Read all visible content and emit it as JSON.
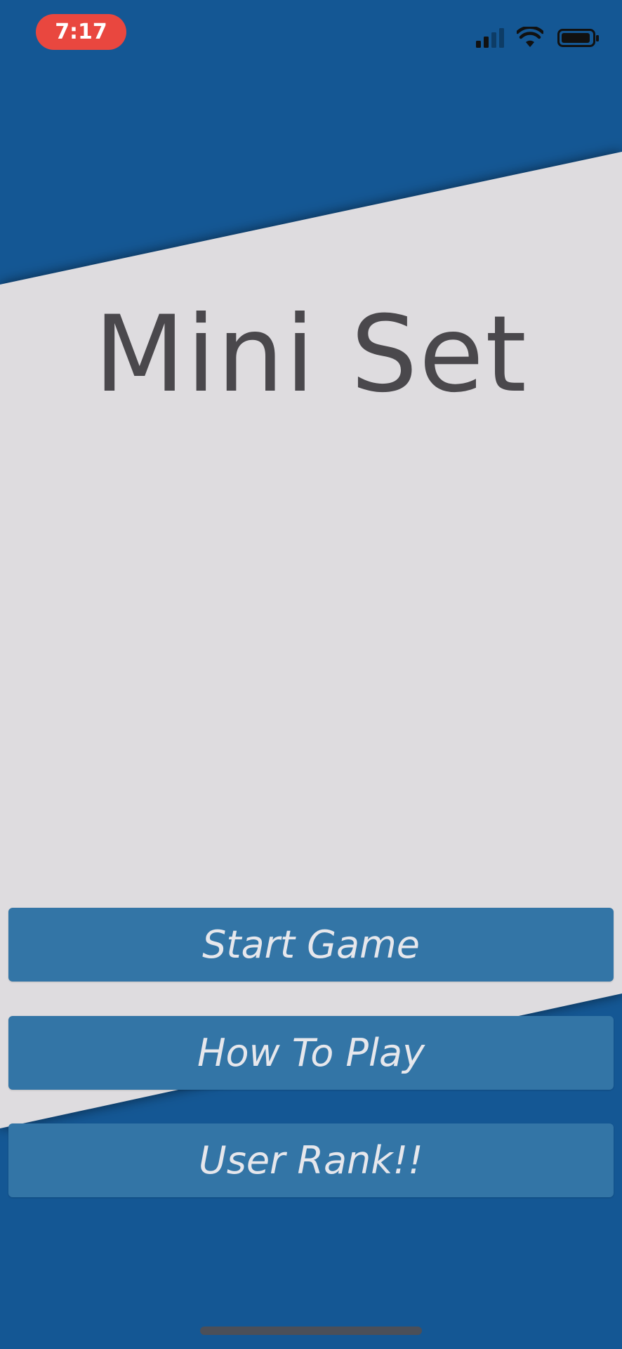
{
  "status_bar": {
    "time": "7:17",
    "signal_icon": "cellular-signal-icon",
    "wifi_icon": "wifi-icon",
    "battery_icon": "battery-icon"
  },
  "main": {
    "title": "Mini Set"
  },
  "menu": {
    "start_game_label": "Start Game",
    "how_to_play_label": "How To Play",
    "user_rank_label": "User Rank!!"
  },
  "colors": {
    "blue_background": "#145794",
    "light_panel": "#dedcdf",
    "button_fill": "#3375a6",
    "button_text": "#e6e7ec",
    "title_text": "#4a484c",
    "time_pill": "#e9473f"
  }
}
